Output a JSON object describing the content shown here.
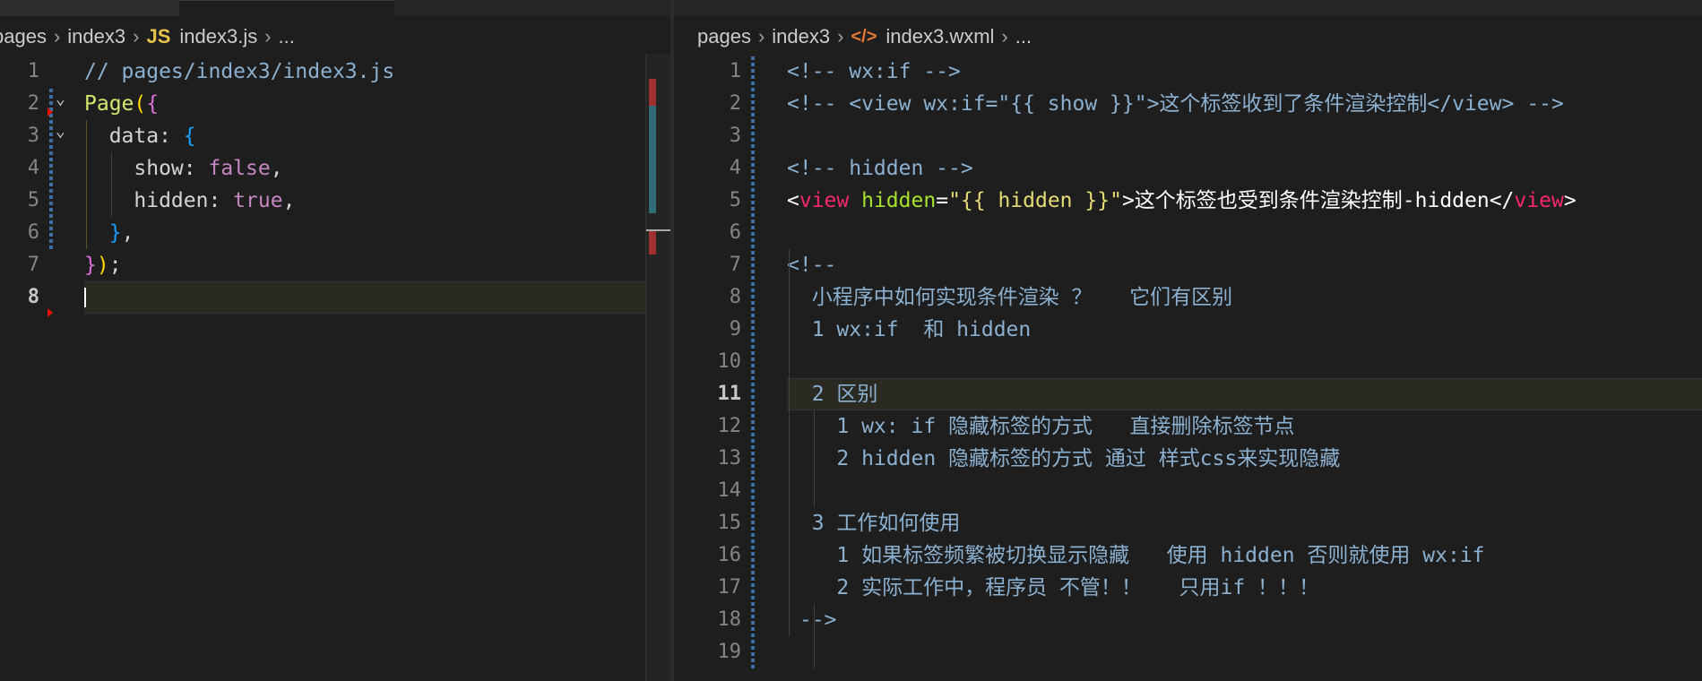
{
  "left_editor": {
    "breadcrumb": {
      "items": [
        "pages",
        "index3"
      ],
      "file_badge": "JS",
      "file_name": "index3.js",
      "ellipsis": "..."
    },
    "lines": [
      {
        "num": "1",
        "tokens": [
          {
            "t": "// pages/index3/index3.js",
            "c": "c-comment2"
          }
        ]
      },
      {
        "num": "2",
        "tokens": [
          {
            "t": "Page",
            "c": "c-fn"
          },
          {
            "t": "(",
            "c": "c-brace-y"
          },
          {
            "t": "{",
            "c": "c-brace-p"
          }
        ]
      },
      {
        "num": "3",
        "tokens": [
          {
            "t": "  data: ",
            "c": "c-key"
          },
          {
            "t": "{",
            "c": "c-brace-b"
          }
        ]
      },
      {
        "num": "4",
        "tokens": [
          {
            "t": "    show: ",
            "c": "c-key"
          },
          {
            "t": "false",
            "c": "c-bool"
          },
          {
            "t": ",",
            "c": "c-punc"
          }
        ]
      },
      {
        "num": "5",
        "tokens": [
          {
            "t": "    hidden: ",
            "c": "c-key"
          },
          {
            "t": "true",
            "c": "c-bool"
          },
          {
            "t": ",",
            "c": "c-punc"
          }
        ]
      },
      {
        "num": "6",
        "tokens": [
          {
            "t": "  ",
            "c": "c-key"
          },
          {
            "t": "}",
            "c": "c-brace-b"
          },
          {
            "t": ",",
            "c": "c-punc"
          }
        ]
      },
      {
        "num": "7",
        "tokens": [
          {
            "t": "}",
            "c": "c-brace-p"
          },
          {
            "t": ")",
            "c": "c-brace-y"
          },
          {
            "t": ";",
            "c": "c-punc"
          }
        ]
      },
      {
        "num": "8",
        "tokens": []
      }
    ],
    "active_line": "8"
  },
  "right_editor": {
    "breadcrumb": {
      "items": [
        "pages",
        "index3"
      ],
      "file_badge": "</>",
      "file_name": "index3.wxml",
      "ellipsis": "..."
    },
    "lines": [
      {
        "num": "1",
        "tokens": [
          {
            "t": "<!-- wx:if -->",
            "c": "c-comment2"
          }
        ]
      },
      {
        "num": "2",
        "tokens": [
          {
            "t": "<!-- <view wx:if=\"{{ show }}\">这个标签收到了条件渲染控制</view> -->",
            "c": "c-comment2"
          }
        ]
      },
      {
        "num": "3",
        "tokens": []
      },
      {
        "num": "4",
        "tokens": [
          {
            "t": "<!-- hidden -->",
            "c": "c-comment2"
          }
        ]
      },
      {
        "num": "5",
        "tokens": [
          {
            "t": "<",
            "c": "c-white"
          },
          {
            "t": "view",
            "c": "c-tag"
          },
          {
            "t": " ",
            "c": "c-white"
          },
          {
            "t": "hidden",
            "c": "c-attr"
          },
          {
            "t": "=",
            "c": "c-white"
          },
          {
            "t": "\"{{ hidden }}\"",
            "c": "c-str"
          },
          {
            "t": ">这个标签也受到条件渲染控制-hidden</",
            "c": "c-white"
          },
          {
            "t": "view",
            "c": "c-tag"
          },
          {
            "t": ">",
            "c": "c-white"
          }
        ]
      },
      {
        "num": "6",
        "tokens": []
      },
      {
        "num": "7",
        "tokens": [
          {
            "t": "<!--",
            "c": "c-comment2"
          }
        ]
      },
      {
        "num": "8",
        "tokens": [
          {
            "t": "  小程序中如何实现条件渲染 ？   它们有区别",
            "c": "c-comment2"
          }
        ]
      },
      {
        "num": "9",
        "tokens": [
          {
            "t": "  1 wx:if  和 hidden",
            "c": "c-comment2"
          }
        ]
      },
      {
        "num": "10",
        "tokens": []
      },
      {
        "num": "11",
        "tokens": [
          {
            "t": "  2 区别",
            "c": "c-comment2"
          }
        ]
      },
      {
        "num": "12",
        "tokens": [
          {
            "t": "    1 wx: if 隐藏标签的方式   直接删除标签节点",
            "c": "c-comment2"
          }
        ]
      },
      {
        "num": "13",
        "tokens": [
          {
            "t": "    2 hidden 隐藏标签的方式 通过 样式css来实现隐藏",
            "c": "c-comment2"
          }
        ]
      },
      {
        "num": "14",
        "tokens": []
      },
      {
        "num": "15",
        "tokens": [
          {
            "t": "  3 工作如何使用",
            "c": "c-comment2"
          }
        ]
      },
      {
        "num": "16",
        "tokens": [
          {
            "t": "    1 如果标签频繁被切换显示隐藏   使用 hidden 否则就使用 wx:if",
            "c": "c-comment2"
          }
        ]
      },
      {
        "num": "17",
        "tokens": [
          {
            "t": "    2 实际工作中，程序员 不管！！   只用if ！！！",
            "c": "c-comment2"
          }
        ]
      },
      {
        "num": "18",
        "tokens": [
          {
            "t": " -->",
            "c": "c-comment2"
          }
        ]
      },
      {
        "num": "19",
        "tokens": []
      }
    ],
    "active_line": "11"
  },
  "colors": {
    "background": "#1e1e1e",
    "accent_js": "#e6c34a",
    "accent_xml": "#e37933"
  }
}
